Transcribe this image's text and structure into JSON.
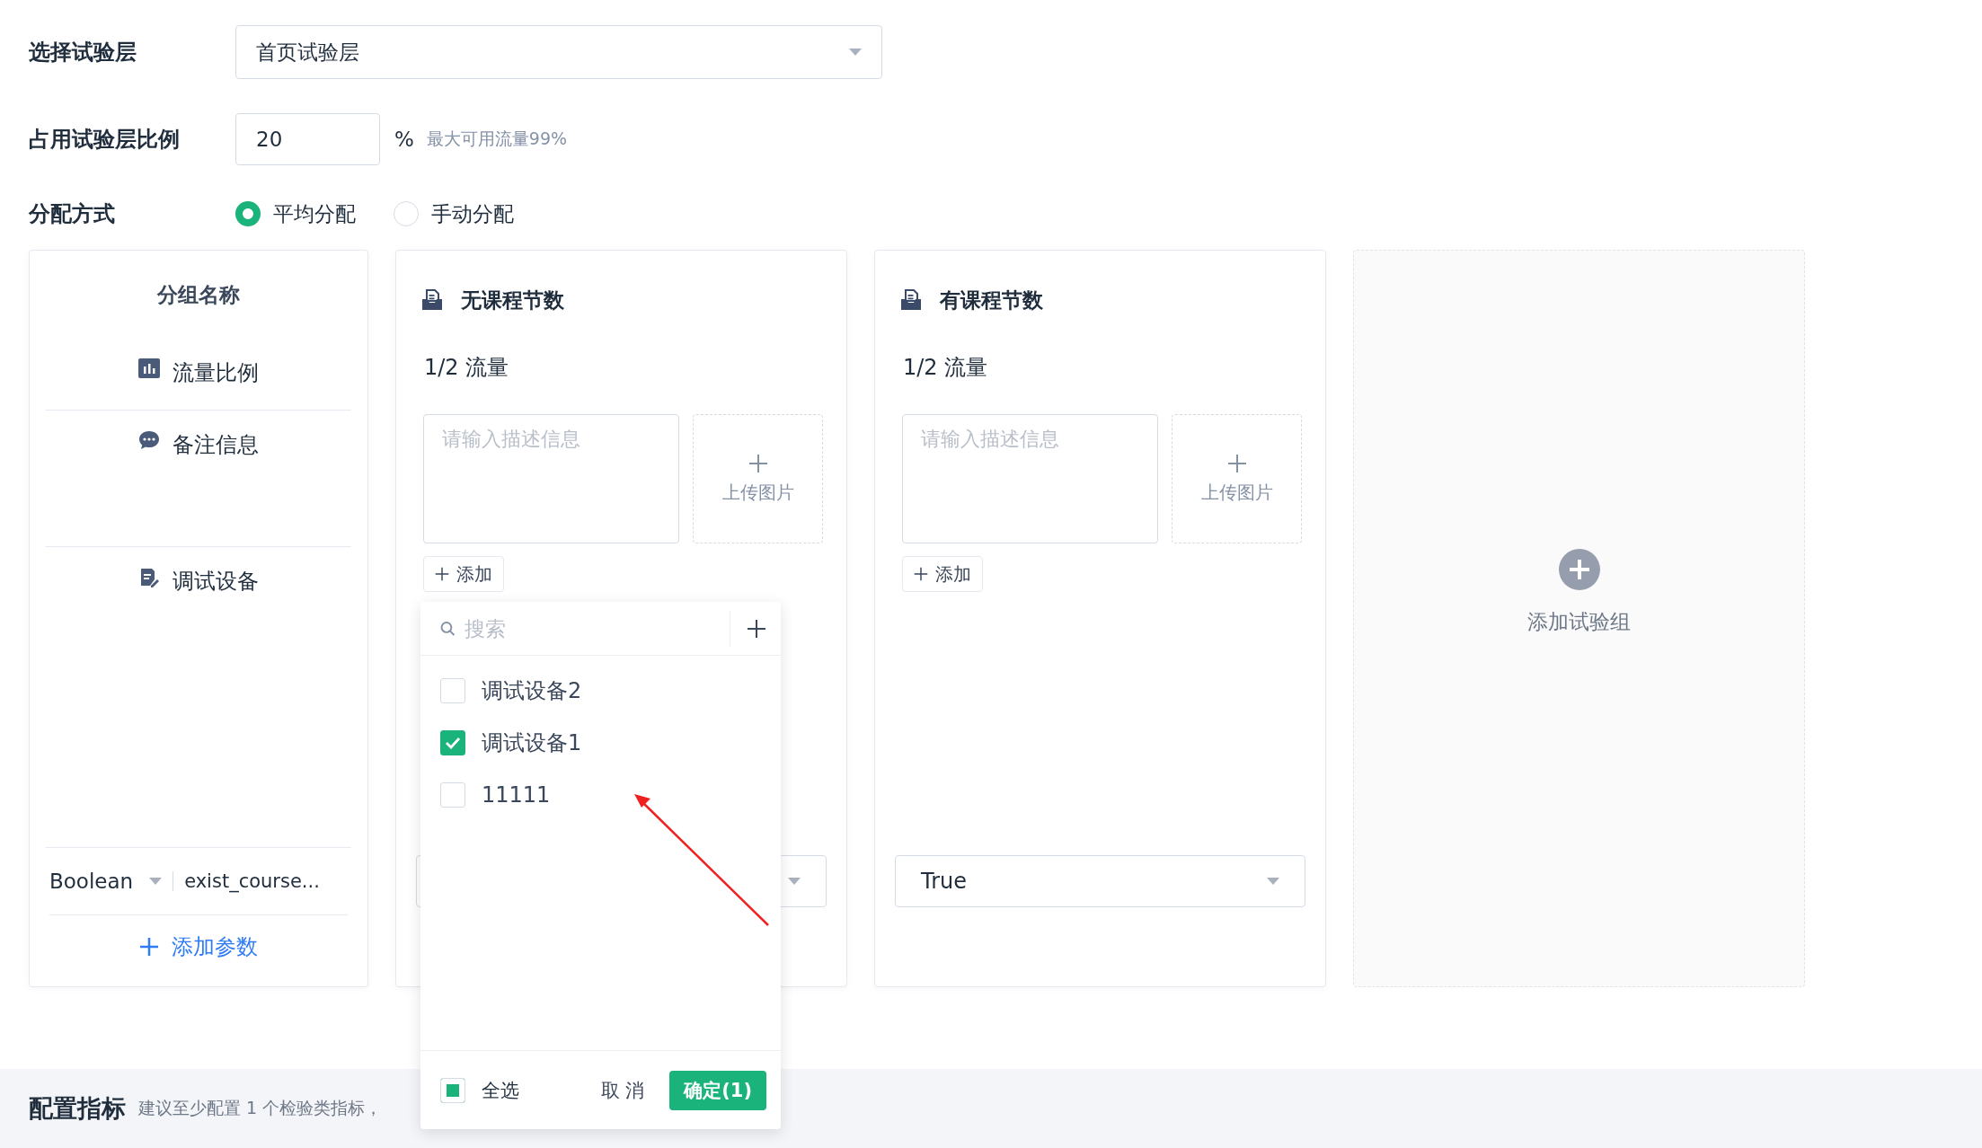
{
  "form": {
    "layer": {
      "label": "选择试验层",
      "value": "首页试验层"
    },
    "ratio": {
      "label": "占用试验层比例",
      "value": "20",
      "unit": "%",
      "hint": "最大可用流量99%"
    },
    "allocation": {
      "label": "分配方式",
      "options": [
        {
          "label": "平均分配",
          "selected": true
        },
        {
          "label": "手动分配",
          "selected": false
        }
      ]
    }
  },
  "row_headers": {
    "title": "分组名称",
    "rows": [
      {
        "kind": "traffic",
        "label": "流量比例"
      },
      {
        "kind": "note",
        "label": "备注信息"
      },
      {
        "kind": "device",
        "label": "调试设备"
      }
    ],
    "param": {
      "type": "Boolean",
      "name": "exist_course..."
    },
    "add_param": "添加参数"
  },
  "groups": [
    {
      "title": "无课程节数",
      "traffic": "1/2 流量",
      "description": {
        "placeholder": "请输入描述信息"
      },
      "upload": "上传图片",
      "add": "添加"
    },
    {
      "title": "有课程节数",
      "traffic": "1/2 流量",
      "description": {
        "placeholder": "请输入描述信息"
      },
      "upload": "上传图片",
      "add": "添加",
      "param_value": "True"
    }
  ],
  "add_group": "添加试验组",
  "device_popup": {
    "search": {
      "placeholder": "搜索"
    },
    "items": [
      {
        "label": "调试设备2",
        "checked": false
      },
      {
        "label": "调试设备1",
        "checked": true
      },
      {
        "label": "11111",
        "checked": false
      }
    ],
    "select_all": {
      "label": "全选",
      "checked": false,
      "indeterminate": true
    },
    "cancel": "取 消",
    "confirm": "确定(1)"
  },
  "metrics": {
    "title": "配置指标",
    "hint": "建议至少配置 1 个检验类指标，"
  }
}
